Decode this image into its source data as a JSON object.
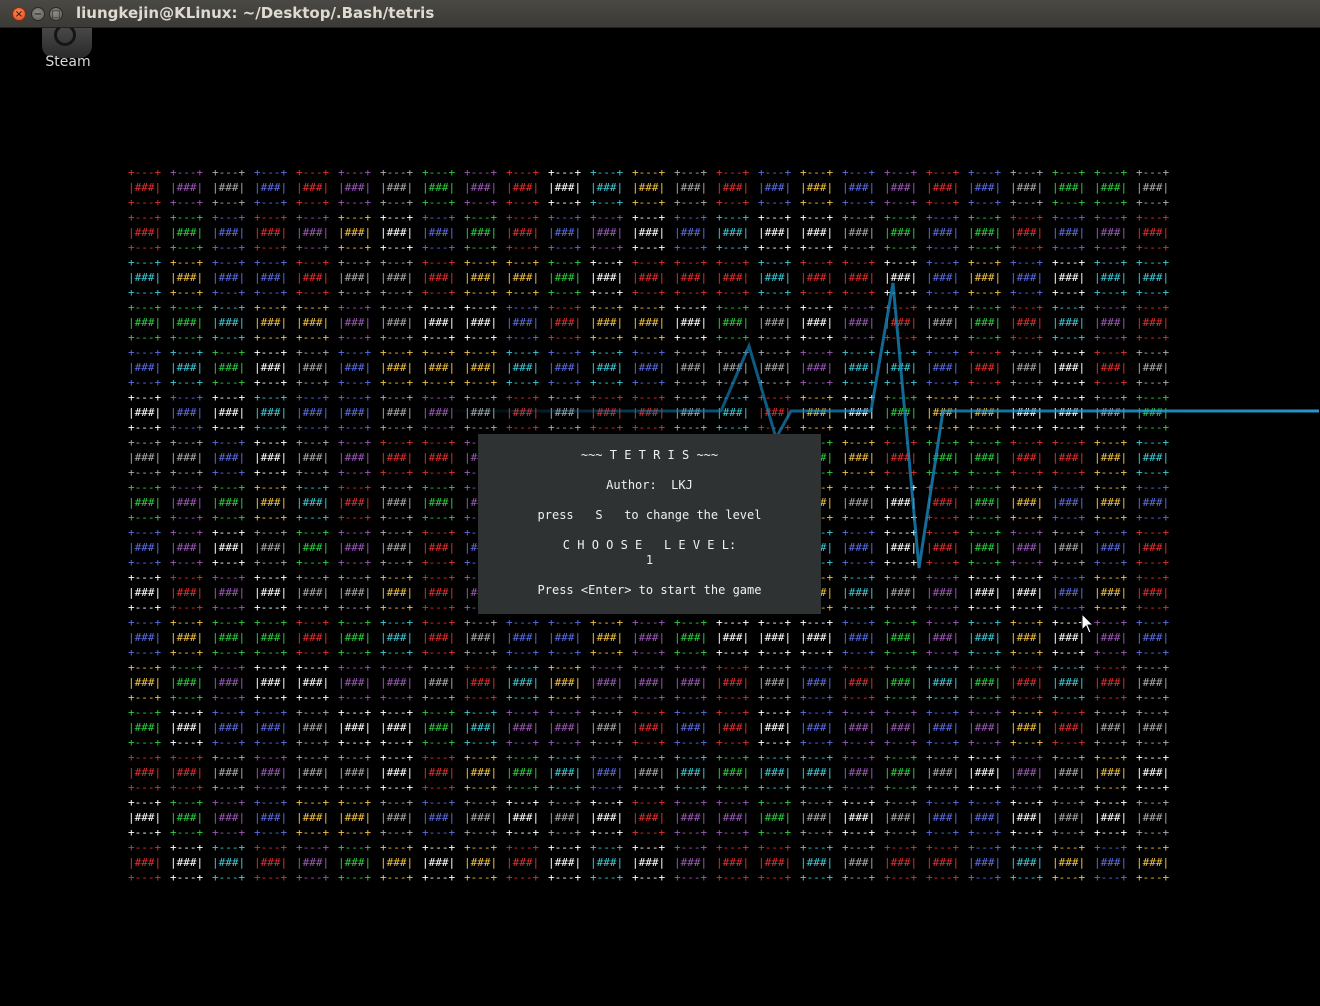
{
  "window": {
    "title": "liungkejin@KLinux: ~/Desktop/.Bash/tetris",
    "close_glyph": "×",
    "minimize_glyph": "−",
    "maximize_glyph": "□"
  },
  "desktop": {
    "icon_label": "Steam"
  },
  "board": {
    "columns": 25,
    "rows": 16,
    "border_glyph": "+---+",
    "cell_glyph": "|###|",
    "colors": [
      "#a9a9a9",
      "#5b6ee1",
      "#ffffff",
      "#e0302e",
      "#9b59b6",
      "#f0c040",
      "#3ec9d6",
      "#2ecc40"
    ]
  },
  "dialog": {
    "title": "~~~ T E T R I S ~~~",
    "author": "Author:  LKJ",
    "hint": "press   S   to change the level",
    "choose_label": "C H O O S E   L E V E L:",
    "level_value": "1",
    "start_hint": "Press <Enter> to start the game"
  }
}
